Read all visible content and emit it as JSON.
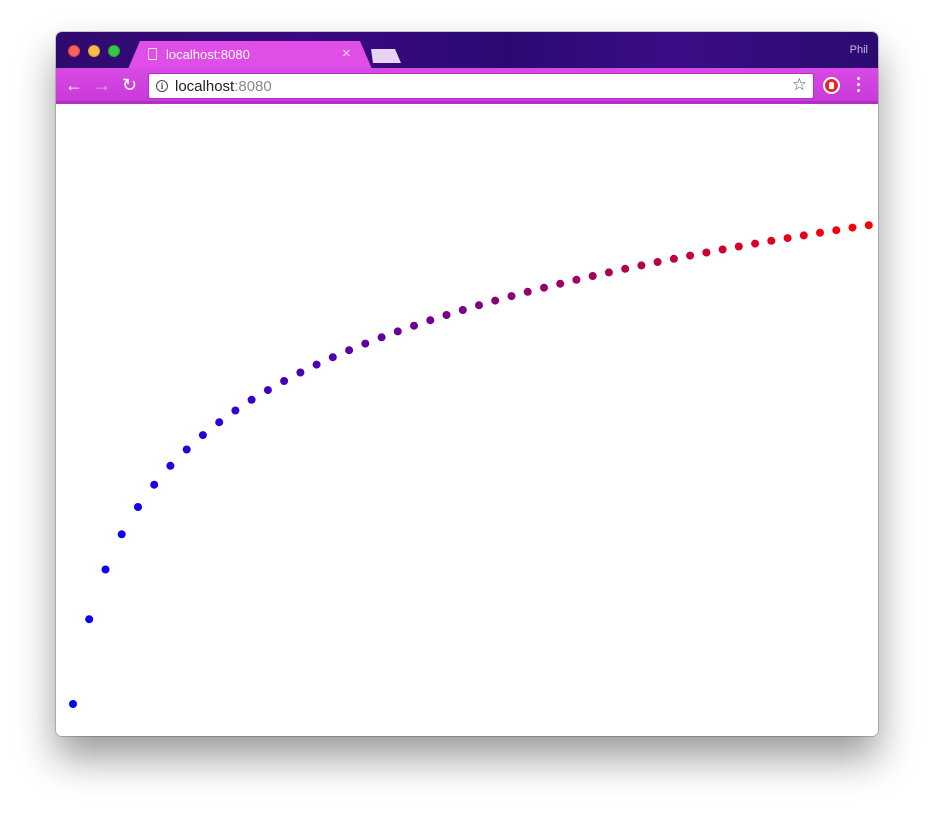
{
  "browser": {
    "tab_title": "localhost:8080",
    "tab_close_symbol": "×",
    "profile_name": "Phil",
    "url_host": "localhost",
    "url_port": ":8080",
    "icons": {
      "back": "back-arrow-icon",
      "forward": "forward-arrow-icon",
      "reload": "reload-icon",
      "info": "info-icon",
      "bookmark": "star-icon",
      "extension": "adblock-extension-icon",
      "menu": "kebab-menu-icon"
    },
    "colors": {
      "tab_background": "#e04ee8",
      "toolbar_background": "#d84ae6",
      "titlebar_background": "#2f0a6e"
    }
  },
  "page": {
    "dot_color_start": "#0000ff",
    "dot_color_end": "#ff0000",
    "dot_count": 50
  }
}
